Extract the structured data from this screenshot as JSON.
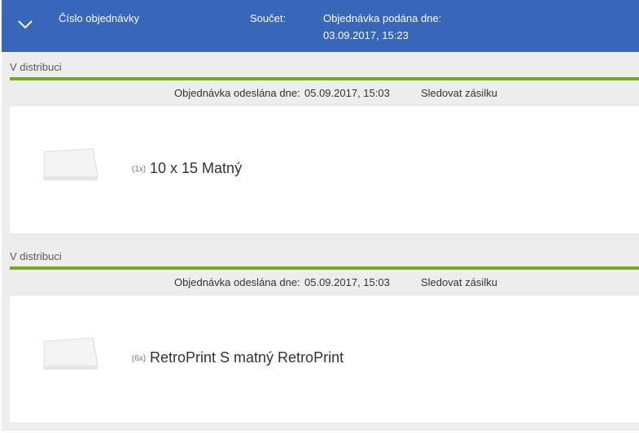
{
  "header": {
    "order_number_label": "Číslo objednávky",
    "total_label": "Součet:",
    "order_placed_label": "Objednávka podána dne:",
    "order_placed_date": "03.09.2017, 15:23",
    "expand_icon": "chevron-down-icon"
  },
  "colors": {
    "header_bg": "#3866b8",
    "status_line": "#78a822",
    "background": "#ededed"
  },
  "shipments": [
    {
      "status": "V distribuci",
      "sent_label": "Objednávka odeslána dne:",
      "sent_date": "05.09.2017, 15:03",
      "track_label": "Sledovat zásilku",
      "item": {
        "qty": "(1x)",
        "name": "10 x 15 Matný"
      }
    },
    {
      "status": "V distribuci",
      "sent_label": "Objednávka odeslána dne:",
      "sent_date": "05.09.2017, 15:03",
      "track_label": "Sledovat zásilku",
      "item": {
        "qty": "(6x)",
        "name": "RetroPrint S matný RetroPrint"
      }
    }
  ]
}
